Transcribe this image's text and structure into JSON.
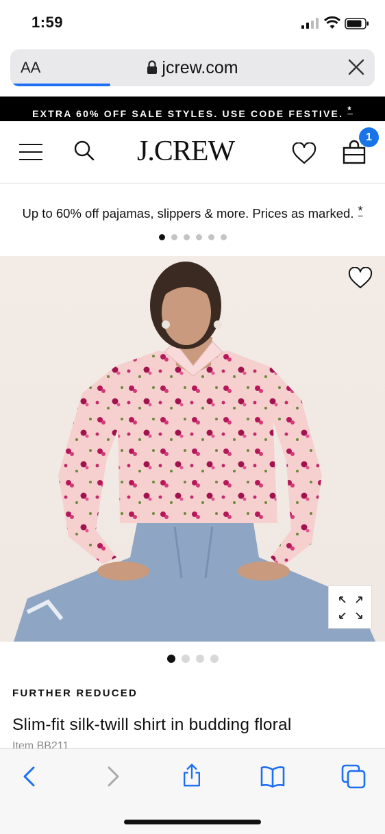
{
  "status_bar": {
    "time": "1:59"
  },
  "address_bar": {
    "text_size_label": "AA",
    "url": "jcrew.com"
  },
  "promo_banner": {
    "text": "EXTRA 60% OFF SALE STYLES. USE CODE FESTIVE.",
    "disclaimer": "*"
  },
  "header": {
    "logo": "J.CREW",
    "bag_count": "1"
  },
  "sub_promo": {
    "text": "Up to 60% off pajamas, slippers & more. Prices as marked.",
    "disclaimer": "*",
    "slide_count": 6,
    "active_slide": 1
  },
  "product": {
    "image_count": 4,
    "active_image": 1,
    "badge": "FURTHER REDUCED",
    "title": "Slim-fit silk-twill shirt in budding floral",
    "item_number": "Item BB211"
  },
  "colors": {
    "bag_badge": "#1874e8",
    "safari_accent": "#1c6ef2",
    "promo_bg": "#000000"
  }
}
